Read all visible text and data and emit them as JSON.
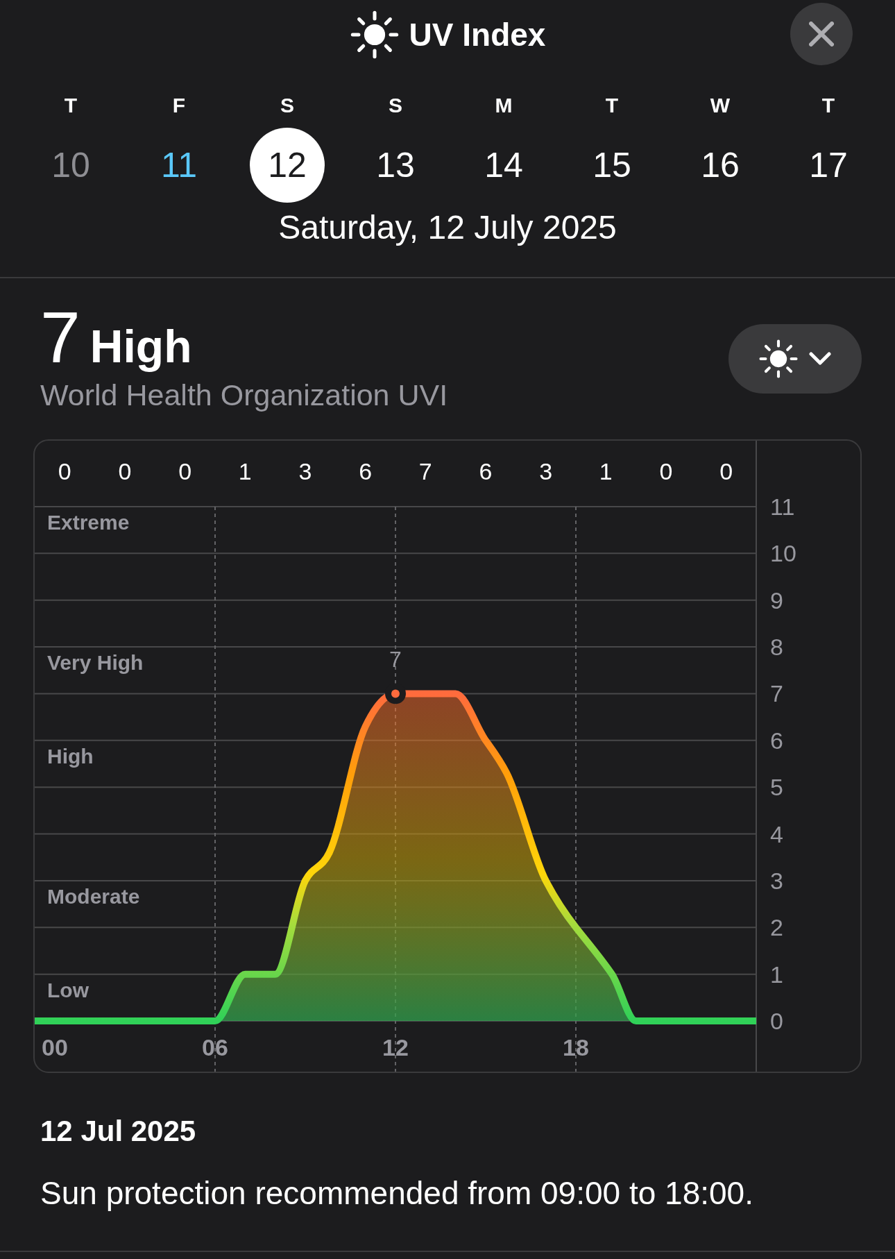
{
  "header": {
    "title": "UV Index"
  },
  "days": [
    {
      "weekday": "T",
      "date": "10",
      "kind": "past",
      "selected": false
    },
    {
      "weekday": "F",
      "date": "11",
      "kind": "today",
      "selected": false
    },
    {
      "weekday": "S",
      "date": "12",
      "kind": "future",
      "selected": true
    },
    {
      "weekday": "S",
      "date": "13",
      "kind": "future",
      "selected": false
    },
    {
      "weekday": "M",
      "date": "14",
      "kind": "future",
      "selected": false
    },
    {
      "weekday": "T",
      "date": "15",
      "kind": "future",
      "selected": false
    },
    {
      "weekday": "W",
      "date": "16",
      "kind": "future",
      "selected": false
    },
    {
      "weekday": "T",
      "date": "17",
      "kind": "future",
      "selected": false
    }
  ],
  "selected_date": "Saturday, 12 July 2025",
  "summary": {
    "value": "7",
    "category": "High",
    "source": "World Health Organization UVI"
  },
  "chart": {
    "category_labels": [
      "Extreme",
      "Very High",
      "High",
      "Moderate",
      "Low"
    ],
    "hourly_values": [
      "0",
      "0",
      "0",
      "1",
      "3",
      "6",
      "7",
      "6",
      "3",
      "1",
      "0",
      "0"
    ],
    "chart_data": {
      "type": "area",
      "grid": true,
      "x": [
        0,
        6,
        7,
        8,
        9,
        9.8,
        11,
        12,
        14,
        15,
        15.7,
        17,
        18,
        19.2,
        20,
        24
      ],
      "values": [
        0,
        0,
        1,
        1,
        3,
        3.6,
        6.3,
        7,
        7,
        6,
        5.3,
        3,
        2,
        1,
        0,
        0
      ],
      "xlim": [
        0,
        24
      ],
      "ylim": [
        0,
        11
      ],
      "xticks": [
        {
          "value": 0,
          "label": "00"
        },
        {
          "value": 6,
          "label": "06"
        },
        {
          "value": 12,
          "label": "12"
        },
        {
          "value": 18,
          "label": "18"
        }
      ],
      "yticks": [
        0,
        1,
        2,
        3,
        4,
        5,
        6,
        7,
        8,
        9,
        10,
        11
      ],
      "annotations": [
        {
          "x": 12,
          "y": 7,
          "text": "7"
        }
      ]
    }
  },
  "note": {
    "date": "12 Jul 2025",
    "text": "Sun protection recommended from 09:00 to 18:00."
  }
}
